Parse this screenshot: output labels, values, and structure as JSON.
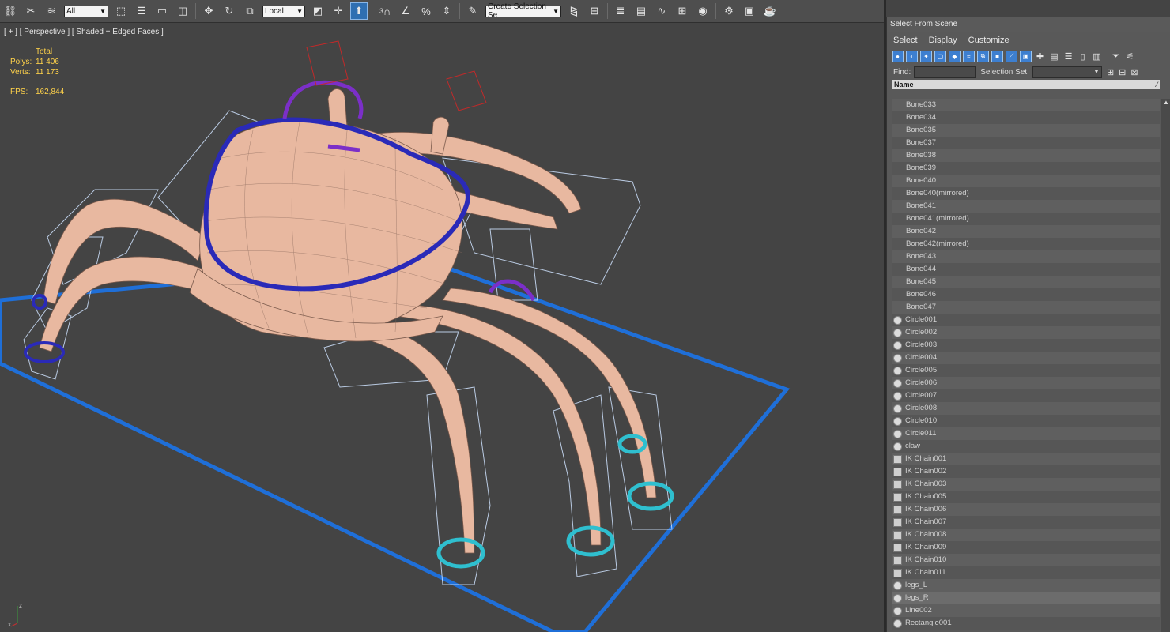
{
  "toolbar": {
    "filter_combo": "All",
    "coord_combo": "Local",
    "snap_label": "3",
    "selection_set_combo": "Create Selection Se",
    "icons": [
      "link-icon",
      "unlink-icon",
      "bind-spacewarp-icon",
      "select-object-icon",
      "select-by-name-icon",
      "rect-region-icon",
      "window-crossing-icon",
      "move-icon",
      "rotate-icon",
      "scale-icon",
      "pivot-icon",
      "manipulate-icon",
      "snap-icon",
      "angle-snap-icon",
      "percent-snap-icon",
      "spinner-snap-icon",
      "edit-named-sets-icon",
      "mirror-icon",
      "align-icon",
      "layer-manager-icon",
      "ribbon-icon",
      "curve-editor-icon",
      "schematic-icon",
      "material-editor-icon",
      "render-setup-icon",
      "render-frame-icon",
      "render-icon"
    ]
  },
  "viewport": {
    "label": "[ + ] [ Perspective ] [ Shaded + Edged Faces ]",
    "stats": {
      "total_label": "Total",
      "polys_label": "Polys:",
      "polys_value": "11 406",
      "verts_label": "Verts:",
      "verts_value": "11 173",
      "fps_label": "FPS:",
      "fps_value": "162,844"
    },
    "axis_labels": {
      "x": "x",
      "z": "z"
    }
  },
  "panel": {
    "title": "Select From Scene",
    "menu": [
      "Select",
      "Display",
      "Customize"
    ],
    "find_label": "Find:",
    "find_value": "",
    "selection_set_label": "Selection Set:",
    "selection_set_value": "",
    "column_header": "Name",
    "items": [
      {
        "name": "Bone033",
        "type": "bone"
      },
      {
        "name": "Bone034",
        "type": "bone"
      },
      {
        "name": "Bone035",
        "type": "bone"
      },
      {
        "name": "Bone037",
        "type": "bone"
      },
      {
        "name": "Bone038",
        "type": "bone"
      },
      {
        "name": "Bone039",
        "type": "bone"
      },
      {
        "name": "Bone040",
        "type": "bone"
      },
      {
        "name": "Bone040(mirrored)",
        "type": "bone"
      },
      {
        "name": "Bone041",
        "type": "bone"
      },
      {
        "name": "Bone041(mirrored)",
        "type": "bone"
      },
      {
        "name": "Bone042",
        "type": "bone"
      },
      {
        "name": "Bone042(mirrored)",
        "type": "bone"
      },
      {
        "name": "Bone043",
        "type": "bone"
      },
      {
        "name": "Bone044",
        "type": "bone"
      },
      {
        "name": "Bone045",
        "type": "bone"
      },
      {
        "name": "Bone046",
        "type": "bone"
      },
      {
        "name": "Bone047",
        "type": "bone"
      },
      {
        "name": "Circle001",
        "type": "shape"
      },
      {
        "name": "Circle002",
        "type": "shape"
      },
      {
        "name": "Circle003",
        "type": "shape"
      },
      {
        "name": "Circle004",
        "type": "shape"
      },
      {
        "name": "Circle005",
        "type": "shape"
      },
      {
        "name": "Circle006",
        "type": "shape"
      },
      {
        "name": "Circle007",
        "type": "shape"
      },
      {
        "name": "Circle008",
        "type": "shape"
      },
      {
        "name": "Circle010",
        "type": "shape"
      },
      {
        "name": "Circle011",
        "type": "shape"
      },
      {
        "name": "claw",
        "type": "mesh"
      },
      {
        "name": "IK Chain001",
        "type": "ik"
      },
      {
        "name": "IK Chain002",
        "type": "ik"
      },
      {
        "name": "IK Chain003",
        "type": "ik"
      },
      {
        "name": "IK Chain005",
        "type": "ik"
      },
      {
        "name": "IK Chain006",
        "type": "ik"
      },
      {
        "name": "IK Chain007",
        "type": "ik"
      },
      {
        "name": "IK Chain008",
        "type": "ik"
      },
      {
        "name": "IK Chain009",
        "type": "ik"
      },
      {
        "name": "IK Chain010",
        "type": "ik"
      },
      {
        "name": "IK Chain011",
        "type": "ik"
      },
      {
        "name": "legs_L",
        "type": "mesh"
      },
      {
        "name": "legs_R",
        "type": "mesh",
        "highlighted": true
      },
      {
        "name": "Line002",
        "type": "shape"
      },
      {
        "name": "Rectangle001",
        "type": "shape"
      }
    ]
  },
  "colors": {
    "viewport_bg": "#444444",
    "mesh": "#e8b8a0",
    "ik_ring": "#2fbfcf",
    "spine_control": "#2a2ab8",
    "purple_control": "#7b2fc8",
    "ground_rect": "#1f6fd8",
    "stats_text": "#ffd24a"
  }
}
